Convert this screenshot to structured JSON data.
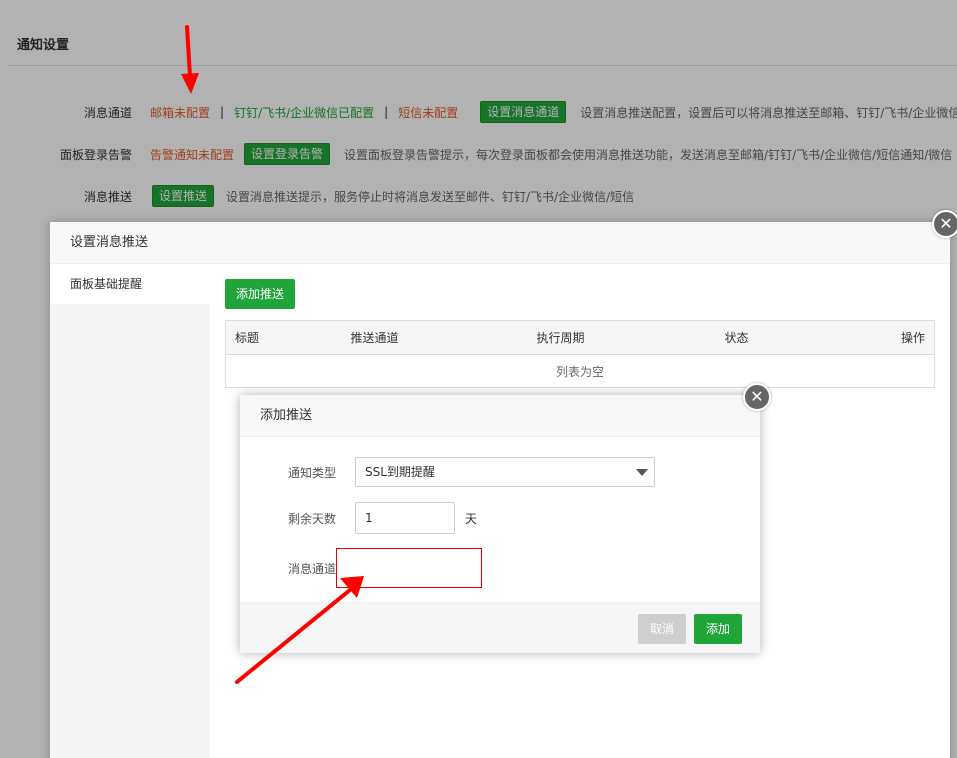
{
  "settings_page": {
    "title": "通知设置",
    "rows": [
      {
        "label": "消息通道",
        "status_email": "邮箱未配置",
        "sep1": "|",
        "status_im": "钉钉/飞书/企业微信已配置",
        "sep2": "|",
        "status_sms": "短信未配置",
        "button": "设置消息通道",
        "hint": "设置消息推送配置，设置后可以将消息推送至邮箱、钉钉/飞书/企业微信"
      },
      {
        "label": "面板登录告警",
        "status": "告警通知未配置",
        "button": "设置登录告警",
        "hint": "设置面板登录告警提示，每次登录面板都会使用消息推送功能，发送消息至邮箱/钉钉/飞书/企业微信/短信通知/微信"
      },
      {
        "label": "消息推送",
        "button": "设置推送",
        "hint": "设置消息推送提示，服务停止时将消息发送至邮件、钉钉/飞书/企业微信/短信"
      }
    ]
  },
  "push_dialog": {
    "title": "设置消息推送",
    "sidebar_items": [
      "面板基础提醒"
    ],
    "add_button": "添加推送",
    "table": {
      "columns": [
        "标题",
        "推送通道",
        "执行周期",
        "状态",
        "操作"
      ],
      "empty_text": "列表为空"
    }
  },
  "add_dialog": {
    "title": "添加推送",
    "notify_type_label": "通知类型",
    "notify_type_value": "SSL到期提醒",
    "days_label": "剩余天数",
    "days_value": "1",
    "days_unit": "天",
    "channel_label": "消息通道",
    "cancel_label": "取消",
    "confirm_label": "添加"
  },
  "colors": {
    "accent_green": "#20a53a",
    "status_red": "#e25a2c",
    "annotation_red": "#ff0000"
  }
}
